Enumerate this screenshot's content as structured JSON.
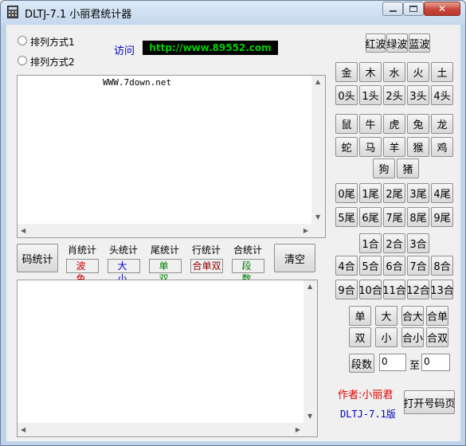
{
  "window": {
    "title": "DLTJ-7.1 小丽君统计器",
    "accent": "#c9453a"
  },
  "options": {
    "radio1": "排列方式1",
    "radio2": "排列方式2"
  },
  "visit": {
    "label": "访问",
    "url": "http://www.89552.com"
  },
  "colors_buttons": [
    "红波",
    "绿波",
    "蓝波"
  ],
  "wuxing": [
    "金",
    "木",
    "水",
    "火",
    "土"
  ],
  "tou": [
    "0头",
    "1头",
    "2头",
    "3头",
    "4头"
  ],
  "zodiac_row1": [
    "鼠",
    "牛",
    "虎",
    "兔",
    "龙"
  ],
  "zodiac_row2": [
    "蛇",
    "马",
    "羊",
    "猴",
    "鸡"
  ],
  "zodiac_row3": [
    "狗",
    "猪"
  ],
  "wei_row1": [
    "0尾",
    "1尾",
    "2尾",
    "3尾",
    "4尾"
  ],
  "wei_row2": [
    "5尾",
    "6尾",
    "7尾",
    "8尾",
    "9尾"
  ],
  "he_row1": [
    "1合",
    "2合",
    "3合"
  ],
  "he_row2": [
    "4合",
    "5合",
    "6合",
    "7合",
    "8合"
  ],
  "he_row3": [
    "9合",
    "10合",
    "11合",
    "12合",
    "13合"
  ],
  "odd_even_row1": [
    "单",
    "大",
    "合大",
    "合单"
  ],
  "odd_even_row2": [
    "双",
    "小",
    "合小",
    "合双"
  ],
  "segment": {
    "label": "段数",
    "from": "0",
    "to_label": "至",
    "to": "0"
  },
  "top_text": "WWW.7down.net",
  "stats": {
    "code": "码统计",
    "zodiac": {
      "label": "肖统计",
      "sub": "波 色"
    },
    "head": {
      "label": "头统计",
      "sub": "大 小"
    },
    "tail": {
      "label": "尾统计",
      "sub": "单 双"
    },
    "row": {
      "label": "行统计",
      "sub": "合单双"
    },
    "he": {
      "label": "合统计",
      "sub": "段 数"
    },
    "clear": "清空"
  },
  "footer": {
    "author": "作者:小丽君",
    "version": "DLTJ-7.1版",
    "open_button": "打开号码页"
  }
}
